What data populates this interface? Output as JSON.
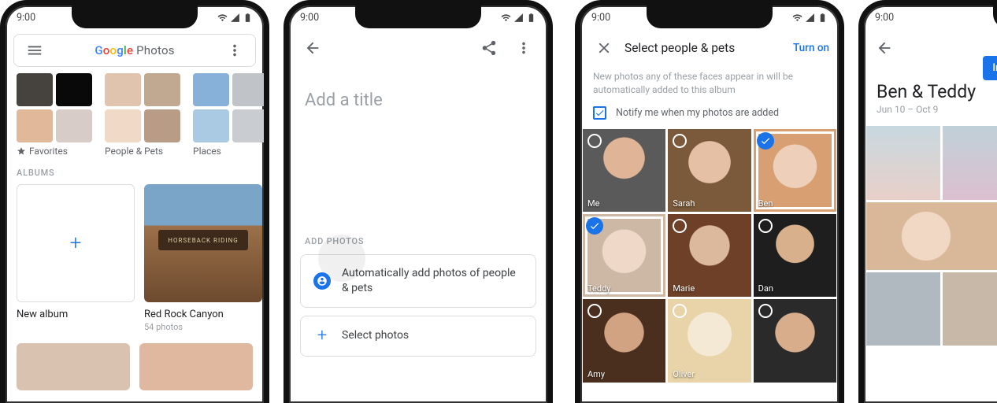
{
  "status_time": "9:00",
  "phone1": {
    "brand_suffix": " Photos",
    "categories": [
      {
        "label": "Favorites",
        "icon": "star"
      },
      {
        "label": "People & Pets"
      },
      {
        "label": "Places"
      }
    ],
    "section_albums": "ALBUMS",
    "albums": [
      {
        "title": "New album"
      },
      {
        "title": "Red Rock Canyon",
        "sub": "54 photos",
        "sign": "HORSEBACK RIDING"
      }
    ]
  },
  "phone2": {
    "title_placeholder": "Add a title",
    "section": "ADD PHOTOS",
    "opt_auto": "Automatically add photos of people & pets",
    "opt_select": "Select photos"
  },
  "phone3": {
    "title": "Select people & pets",
    "action": "Turn on",
    "desc": "New photos any of these faces appear in will be automatically added to this album",
    "notify": "Notify me when my photos are added",
    "faces": [
      {
        "name": "Me",
        "sel": false
      },
      {
        "name": "Sarah",
        "sel": false
      },
      {
        "name": "Ben",
        "sel": true
      },
      {
        "name": "Teddy",
        "sel": true
      },
      {
        "name": "Marie",
        "sel": false
      },
      {
        "name": "Dan",
        "sel": false
      },
      {
        "name": "Amy",
        "sel": false
      },
      {
        "name": "Oliver",
        "sel": false
      },
      {
        "name": "",
        "sel": false
      }
    ]
  },
  "phone4": {
    "invite": "Invi",
    "title": "Ben & Teddy",
    "dates": "Jun 10 – Oct 9"
  }
}
